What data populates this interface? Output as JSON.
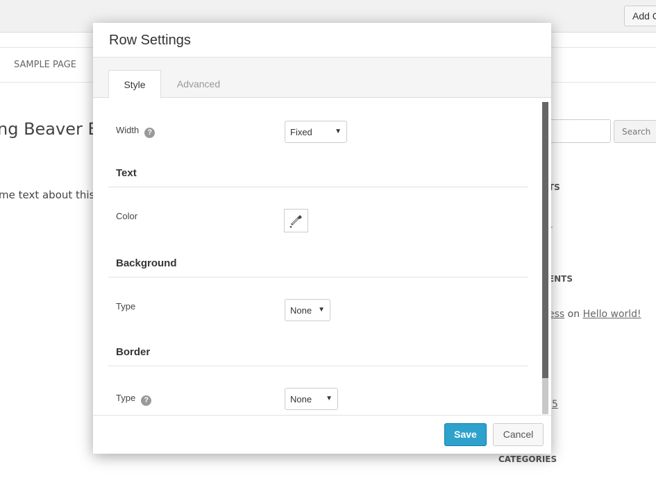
{
  "background": {
    "add_button": "Add C",
    "nav_item": "SAMPLE PAGE",
    "page_title": "ng Beaver Bu",
    "page_text": "me text about this",
    "search_button": "Search",
    "sidebar": {
      "recent_posts_heading": "TS",
      "recent_post_link": "!",
      "recent_comments_heading": "MENTS",
      "comment_author": "ess",
      "comment_on": "on",
      "comment_post": "Hello world!",
      "archive_link": "5",
      "categories_heading": "CATEGORIES"
    }
  },
  "modal": {
    "title": "Row Settings",
    "tabs": [
      {
        "label": "Style",
        "active": true
      },
      {
        "label": "Advanced",
        "active": false
      }
    ],
    "fields": {
      "width_label": "Width",
      "width_value": "Fixed",
      "text_section": "Text",
      "color_label": "Color",
      "background_section": "Background",
      "bg_type_label": "Type",
      "bg_type_value": "None",
      "border_section": "Border",
      "border_type_label": "Type",
      "border_type_value": "None"
    },
    "help_glyph": "?",
    "dropdown_arrow": "▼",
    "save_label": "Save",
    "cancel_label": "Cancel",
    "accent_color": "#2ea2cc"
  }
}
